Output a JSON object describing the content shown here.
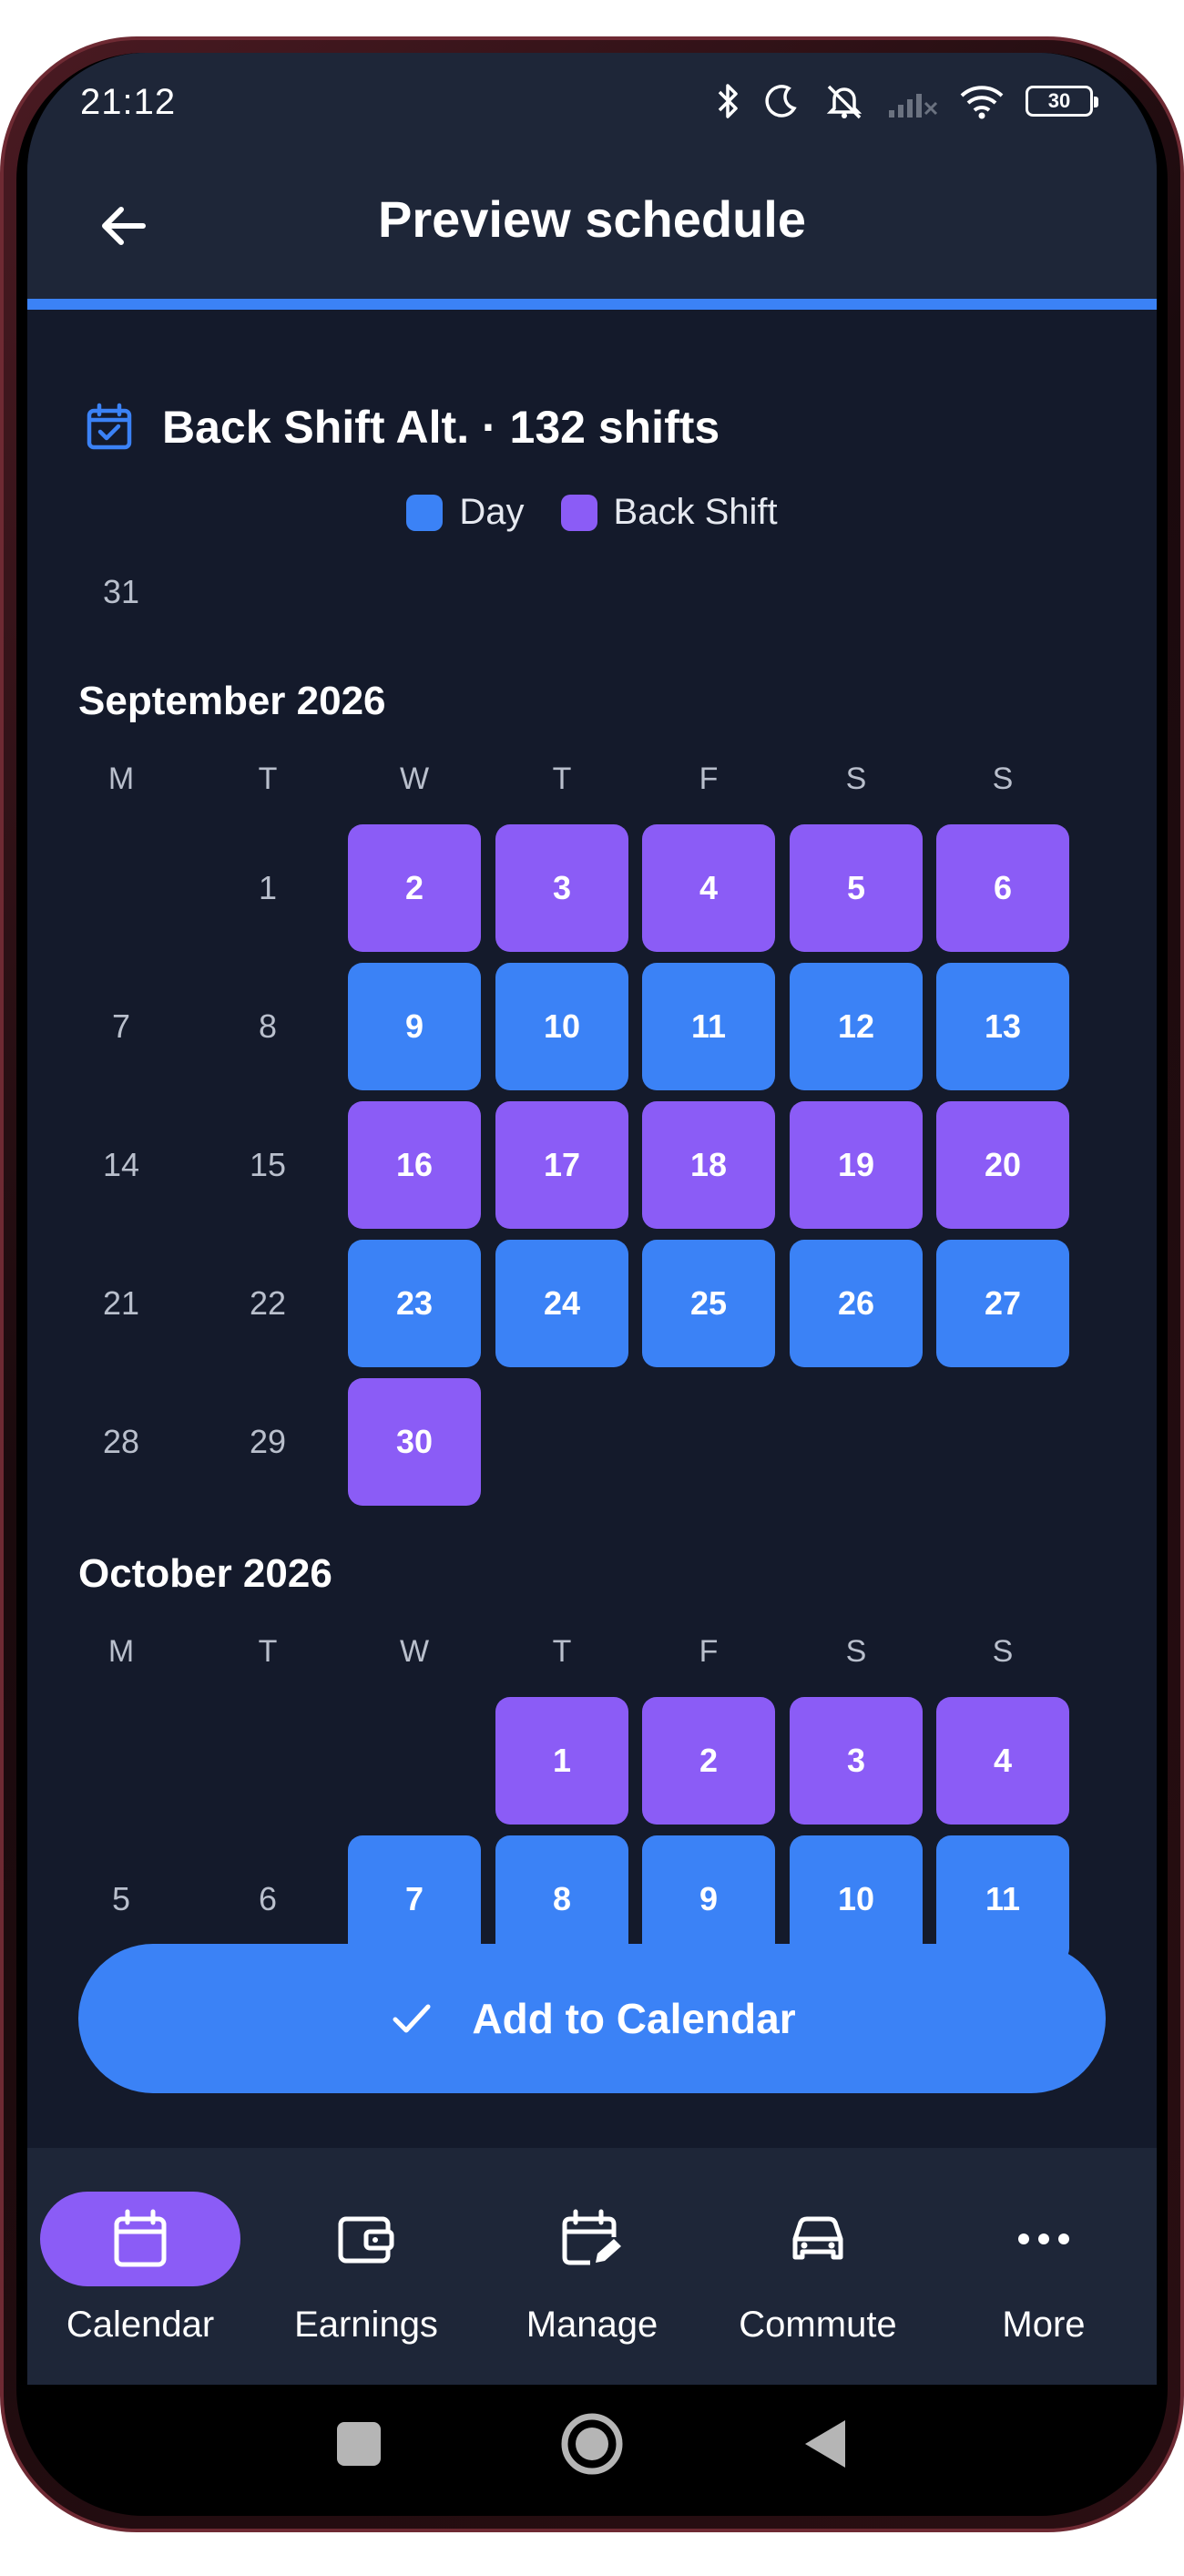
{
  "status_bar": {
    "time": "21:12",
    "battery": "30",
    "icons": [
      "bluetooth-icon",
      "moon-icon",
      "alarm-off-icon",
      "signal-icon",
      "wifi-icon",
      "battery-icon"
    ]
  },
  "header": {
    "back_icon": "arrow-left-icon",
    "title": "Preview schedule"
  },
  "summary": {
    "icon": "calendar-check-icon",
    "text": "Back Shift Alt. · 132 shifts"
  },
  "legend": [
    {
      "label": "Day",
      "color": "#3b82f6"
    },
    {
      "label": "Back Shift",
      "color": "#8b5cf6"
    }
  ],
  "weekdays": [
    "M",
    "T",
    "W",
    "T",
    "F",
    "S",
    "S"
  ],
  "previous_tail": {
    "day": "31"
  },
  "months": [
    {
      "title": "September 2026",
      "weeks": [
        [
          null,
          {
            "d": "1"
          },
          {
            "d": "2",
            "s": "back"
          },
          {
            "d": "3",
            "s": "back"
          },
          {
            "d": "4",
            "s": "back"
          },
          {
            "d": "5",
            "s": "back"
          },
          {
            "d": "6",
            "s": "back"
          }
        ],
        [
          {
            "d": "7"
          },
          {
            "d": "8"
          },
          {
            "d": "9",
            "s": "day"
          },
          {
            "d": "10",
            "s": "day"
          },
          {
            "d": "11",
            "s": "day"
          },
          {
            "d": "12",
            "s": "day"
          },
          {
            "d": "13",
            "s": "day"
          }
        ],
        [
          {
            "d": "14"
          },
          {
            "d": "15"
          },
          {
            "d": "16",
            "s": "back"
          },
          {
            "d": "17",
            "s": "back"
          },
          {
            "d": "18",
            "s": "back"
          },
          {
            "d": "19",
            "s": "back"
          },
          {
            "d": "20",
            "s": "back"
          }
        ],
        [
          {
            "d": "21"
          },
          {
            "d": "22"
          },
          {
            "d": "23",
            "s": "day"
          },
          {
            "d": "24",
            "s": "day"
          },
          {
            "d": "25",
            "s": "day"
          },
          {
            "d": "26",
            "s": "day"
          },
          {
            "d": "27",
            "s": "day"
          }
        ],
        [
          {
            "d": "28"
          },
          {
            "d": "29"
          },
          {
            "d": "30",
            "s": "back"
          },
          null,
          null,
          null,
          null
        ]
      ]
    },
    {
      "title": "October 2026",
      "weeks": [
        [
          null,
          null,
          null,
          {
            "d": "1",
            "s": "back"
          },
          {
            "d": "2",
            "s": "back"
          },
          {
            "d": "3",
            "s": "back"
          },
          {
            "d": "4",
            "s": "back"
          }
        ],
        [
          {
            "d": "5"
          },
          {
            "d": "6"
          },
          {
            "d": "7",
            "s": "day"
          },
          {
            "d": "8",
            "s": "day"
          },
          {
            "d": "9",
            "s": "day"
          },
          {
            "d": "10",
            "s": "day"
          },
          {
            "d": "11",
            "s": "day"
          }
        ]
      ]
    }
  ],
  "action": {
    "icon": "check-icon",
    "label": "Add to Calendar"
  },
  "bottom_nav": [
    {
      "label": "Calendar",
      "icon": "calendar-icon",
      "active": true
    },
    {
      "label": "Earnings",
      "icon": "wallet-icon",
      "active": false
    },
    {
      "label": "Manage",
      "icon": "calendar-edit-icon",
      "active": false
    },
    {
      "label": "Commute",
      "icon": "car-icon",
      "active": false
    },
    {
      "label": "More",
      "icon": "more-horizontal-icon",
      "active": false
    }
  ],
  "colors": {
    "accent": "#3b82f6",
    "back_shift": "#8b5cf6",
    "background": "#141a2b",
    "surface": "#1e2638"
  }
}
